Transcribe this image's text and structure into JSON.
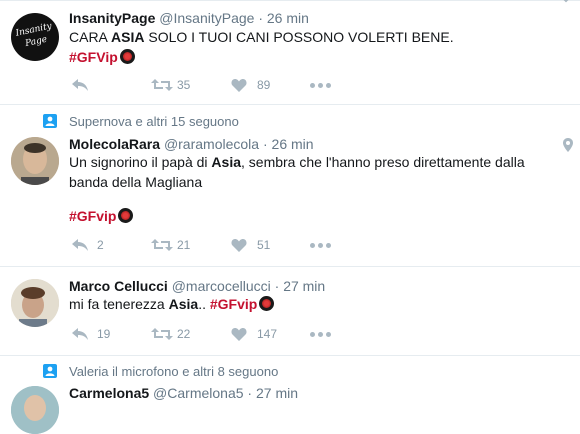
{
  "tweets": [
    {
      "name": "InsanityPage",
      "handle": "@InsanityPage",
      "time": "26 min",
      "text_pre": "CARA ",
      "text_bold": "ASIA",
      "text_post": " SOLO I TUOI CANI POSSONO VOLERTI BENE.",
      "hashtag": "#GFVip",
      "retweets": "35",
      "likes": "89",
      "avatar_text": "Insanity Page"
    },
    {
      "context": "Supernova e altri 15 seguono",
      "name": "MolecolaRara",
      "handle": "@raramolecola",
      "time": "26 min",
      "text_pre": "Un signorino il papà di ",
      "text_bold": "Asia",
      "text_post": ", sembra che l'hanno preso direttamente dalla banda della Magliana",
      "hashtag": "#GFvip",
      "replies": "2",
      "retweets": "21",
      "likes": "51"
    },
    {
      "name": "Marco Cellucci",
      "handle": "@marcocellucci",
      "time": "27 min",
      "text_pre": "mi fa tenerezza ",
      "text_bold": "Asia",
      "text_post": ".. ",
      "hashtag": "#GFvip",
      "replies": "19",
      "retweets": "22",
      "likes": "147"
    },
    {
      "context": "Valeria il microfono e altri 8 seguono",
      "name": "Carmelona5",
      "handle": "@Carmelona5",
      "time": "27 min"
    }
  ],
  "separator_dot": "·",
  "colors": {
    "accent": "#c4112f",
    "muted": "#657786",
    "icon": "#aab8c2",
    "divider": "#e6ecf0"
  },
  "icons": [
    "reply-icon",
    "retweet-icon",
    "like-icon",
    "more-icon",
    "person-icon",
    "location-pin-icon",
    "gf-emoji-icon"
  ]
}
